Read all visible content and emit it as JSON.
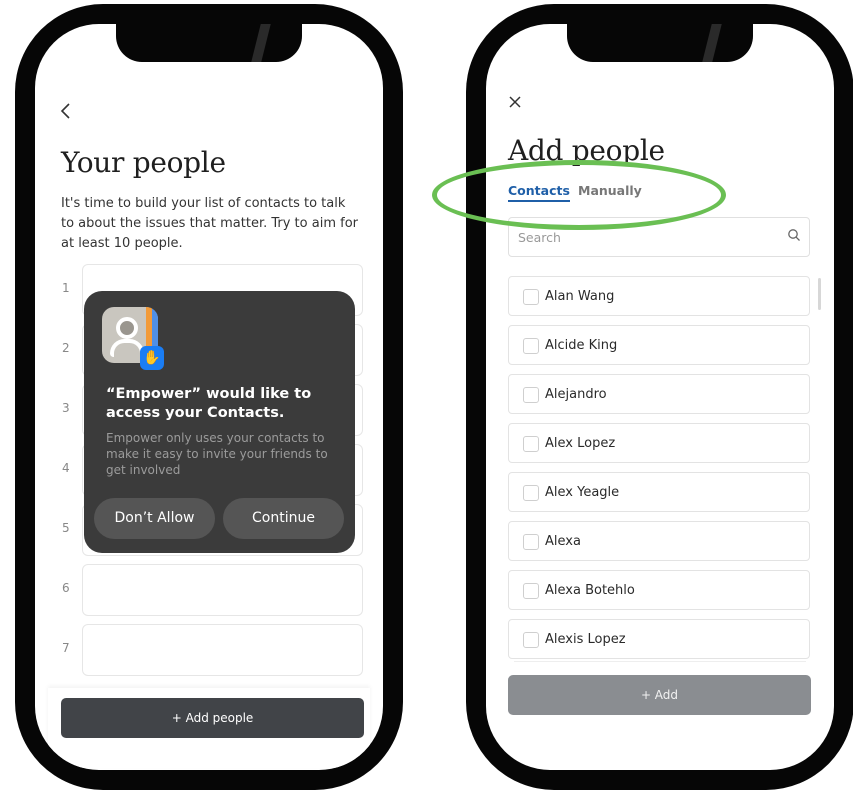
{
  "left_screen": {
    "back_icon": "chevron-left-icon",
    "title": "Your people",
    "intro": "It's time to build your list of contacts to talk to about the issues that matter. Try to aim for at least 10 people.",
    "rows": [
      "1",
      "2",
      "3",
      "4",
      "5",
      "6",
      "7"
    ],
    "permission_dialog": {
      "title": "“Empower” would like to access your Contacts.",
      "body": "Empower only uses your contacts to make it easy to invite your friends to get involved",
      "deny_label": "Don’t Allow",
      "continue_label": "Continue"
    },
    "add_people_label": "+ Add people"
  },
  "right_screen": {
    "close_icon": "close-icon",
    "title": "Add people",
    "tabs": [
      {
        "label": "Contacts",
        "active": true
      },
      {
        "label": "Manually",
        "active": false
      }
    ],
    "search": {
      "placeholder": "Search",
      "icon": "search-icon"
    },
    "contacts": [
      {
        "name": "Alan Wang"
      },
      {
        "name": "Alcide King"
      },
      {
        "name": "Alejandro"
      },
      {
        "name": "Alex Lopez"
      },
      {
        "name": "Alex Yeagle"
      },
      {
        "name": "Alexa"
      },
      {
        "name": "Alexa Botehlo"
      },
      {
        "name": "Alexis Lopez"
      }
    ],
    "add_label": "+ Add"
  },
  "colors": {
    "accent_blue": "#1f5fa8",
    "highlight_green": "#6abf53",
    "button_dark": "#414448",
    "button_disabled": "#8a8d91",
    "dialog_bg": "#3b3b3b"
  }
}
